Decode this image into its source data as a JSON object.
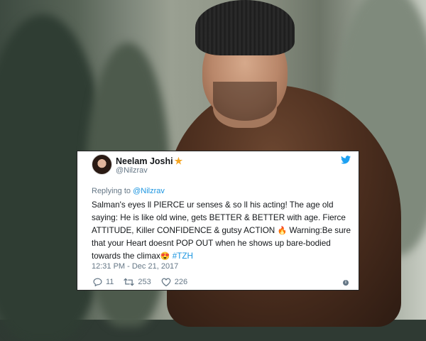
{
  "tweet": {
    "display_name": "Neelam Joshi",
    "badge": "★",
    "handle": "@Nilzrav",
    "replying_prefix": "Replying to ",
    "replying_handle": "@Nilzrav",
    "body_main": "Salman's eyes ll PIERCE ur senses & so ll his acting! The age old saying: He is like old wine, gets BETTER & BETTER with age. Fierce ATTITUDE, Killer CONFIDENCE & gutsy ACTION ",
    "body_warning": " Warning:Be sure that your Heart doesnt POP OUT when he shows up bare-bodied towards the climax",
    "hashtag": "#TZH",
    "timestamp": "12:31 PM - Dec 21, 2017",
    "replies": "11",
    "retweets": "253",
    "likes": "226"
  },
  "icons": [
    "twitter-bird-icon",
    "fire-emoji-icon",
    "heart-eyes-emoji-icon",
    "reply-icon",
    "retweet-icon",
    "like-heart-icon",
    "info-icon"
  ],
  "colors": {
    "link": "#1b95e0",
    "muted": "#657786",
    "text": "#14171a",
    "badge": "#f5a623"
  }
}
